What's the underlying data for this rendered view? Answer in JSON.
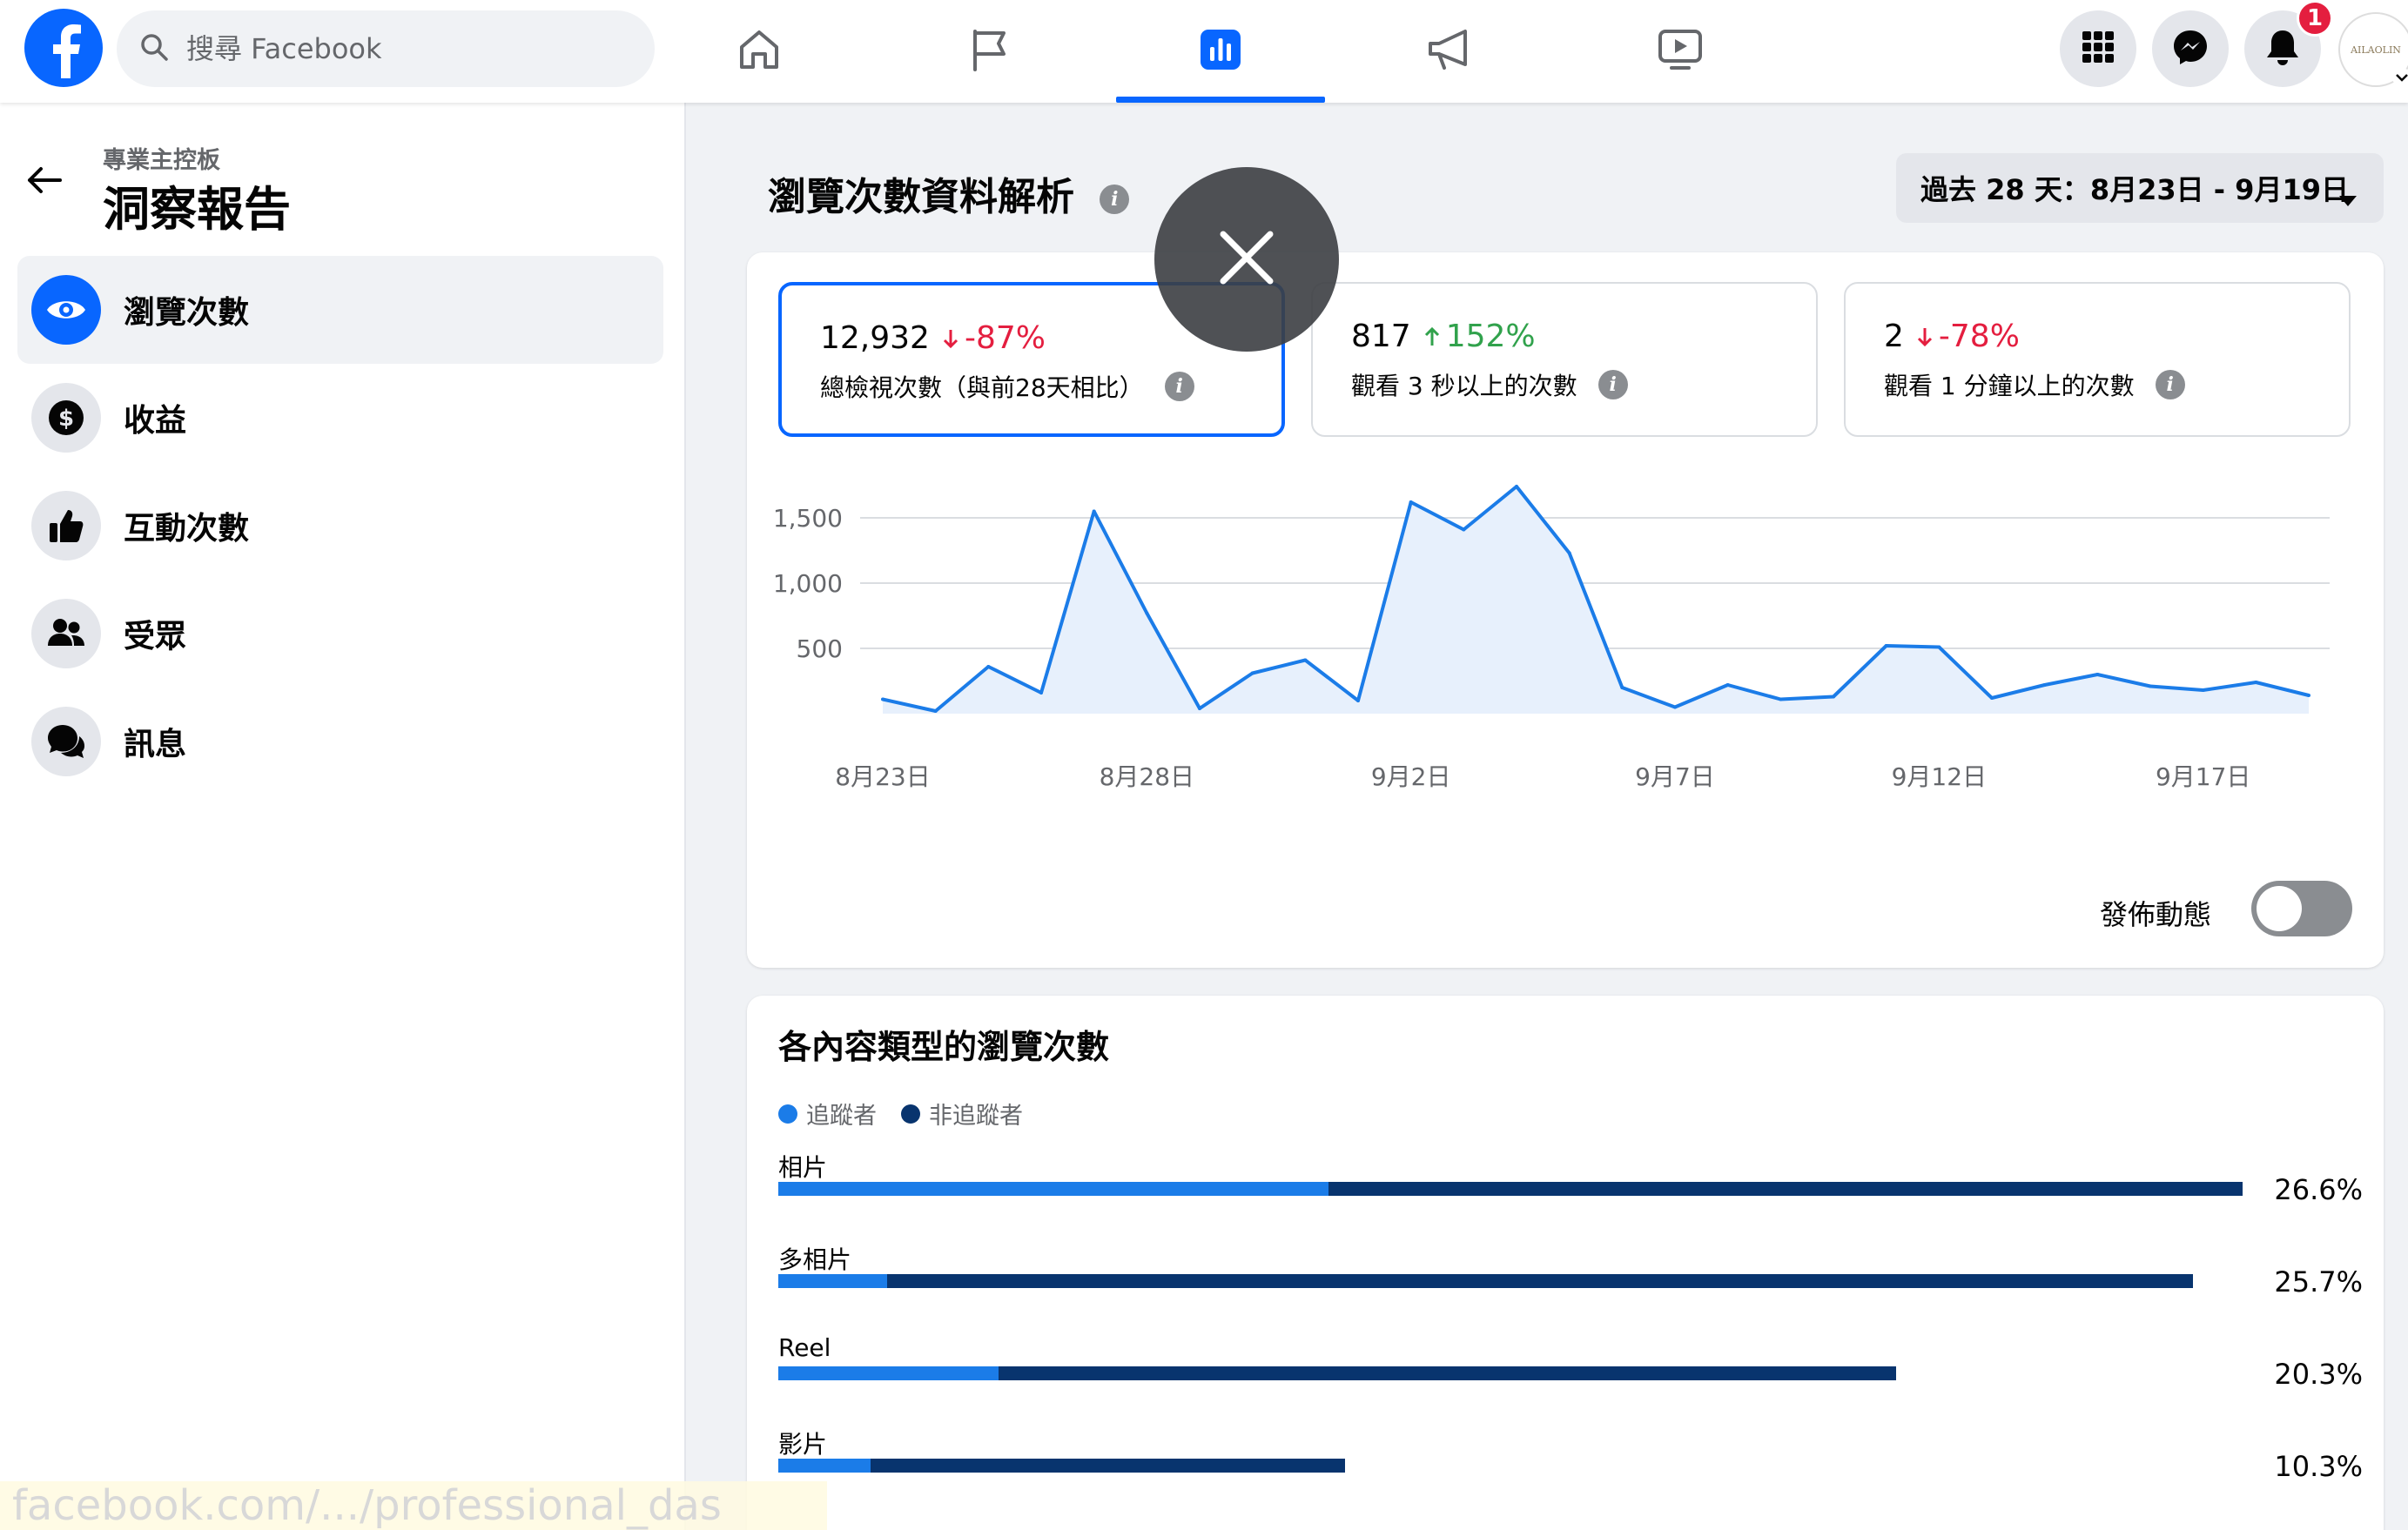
{
  "search": {
    "placeholder": "搜尋 Facebook"
  },
  "topbar": {
    "nav_tabs": [
      {
        "icon": "home-icon"
      },
      {
        "icon": "flag-icon"
      },
      {
        "icon": "insights-icon",
        "active": true
      },
      {
        "icon": "megaphone-icon"
      },
      {
        "icon": "video-icon"
      }
    ],
    "notification_count": "1",
    "avatar_text": "AILAOLIN"
  },
  "sidebar": {
    "breadcrumb": "專業主控板",
    "title": "洞察報告",
    "items": [
      {
        "label": "瀏覽次數",
        "icon": "eye-icon",
        "active": true
      },
      {
        "label": "收益",
        "icon": "dollar-icon"
      },
      {
        "label": "互動次數",
        "icon": "thumbs-up-icon"
      },
      {
        "label": "受眾",
        "icon": "people-icon"
      },
      {
        "label": "訊息",
        "icon": "chat-icon"
      }
    ]
  },
  "main": {
    "section_title": "瀏覽次數資料解析",
    "date_range": "過去 28 天：8月23日 - 9月19日",
    "metrics": [
      {
        "value": "12,932",
        "change": "-87%",
        "direction": "down",
        "label": "總檢視次數（與前28天相比）",
        "active": true
      },
      {
        "value": "817",
        "change": "152%",
        "direction": "up",
        "label": "觀看 3 秒以上的次數"
      },
      {
        "value": "2",
        "change": "-78%",
        "direction": "down",
        "label": "觀看 1 分鐘以上的次數"
      }
    ],
    "toggle_label": "發佈動態",
    "toggle_on": false
  },
  "chart_data": {
    "type": "area",
    "x": [
      "8月23日",
      "8月24日",
      "8月25日",
      "8月26日",
      "8月27日",
      "8月28日",
      "8月29日",
      "8月30日",
      "8月31日",
      "9月1日",
      "9月2日",
      "9月3日",
      "9月4日",
      "9月5日",
      "9月6日",
      "9月7日",
      "9月8日",
      "9月9日",
      "9月10日",
      "9月11日",
      "9月12日",
      "9月13日",
      "9月14日",
      "9月15日",
      "9月16日",
      "9月17日",
      "9月18日",
      "9月19日"
    ],
    "tick_labels": [
      "8月23日",
      "8月28日",
      "9月2日",
      "9月7日",
      "9月12日",
      "9月17日"
    ],
    "values": [
      110,
      20,
      360,
      160,
      1550,
      770,
      40,
      310,
      410,
      100,
      1620,
      1410,
      1740,
      1230,
      200,
      50,
      220,
      110,
      130,
      520,
      510,
      120,
      220,
      300,
      210,
      180,
      240,
      140
    ],
    "y_ticks": [
      500,
      1000,
      1500
    ],
    "ylim": [
      0,
      1800
    ],
    "color": "#1b7ce8",
    "fill": "#e7f0fc",
    "grid": true
  },
  "content_types": {
    "title": "各內容類型的瀏覽次數",
    "legend": [
      {
        "label": "追蹤者",
        "color": "#1b7ce8"
      },
      {
        "label": "非追蹤者",
        "color": "#08346e"
      }
    ],
    "rows": [
      {
        "label": "相片",
        "pct": "26.6%",
        "share": 26.6,
        "follower_fraction": 0.376
      },
      {
        "label": "多相片",
        "pct": "25.7%",
        "share": 25.7,
        "follower_fraction": 0.077
      },
      {
        "label": "Reel",
        "pct": "20.3%",
        "share": 20.3,
        "follower_fraction": 0.197
      },
      {
        "label": "影片",
        "pct": "10.3%",
        "share": 10.3,
        "follower_fraction": 0.163
      }
    ]
  },
  "overlay": {
    "url_hint": "facebook.com/.../professional_das"
  }
}
